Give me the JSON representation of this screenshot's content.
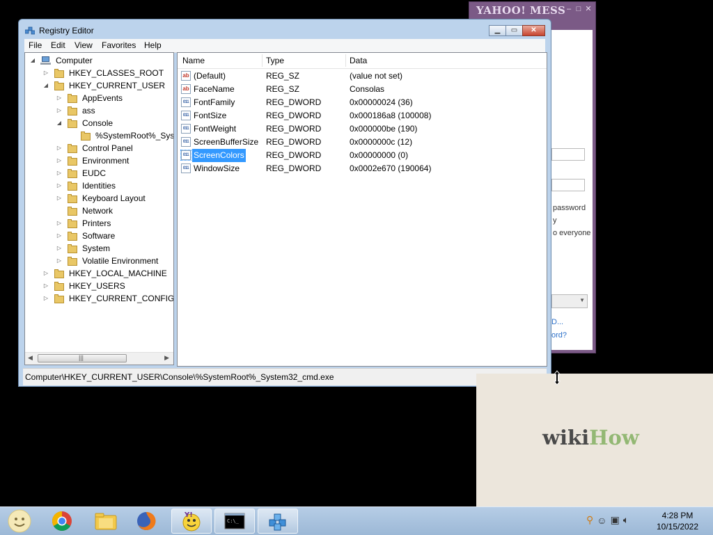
{
  "registry": {
    "title": "Registry Editor",
    "menu": [
      "File",
      "Edit",
      "View",
      "Favorites",
      "Help"
    ],
    "tree": {
      "root": "Computer",
      "hkcr": "HKEY_CLASSES_ROOT",
      "hkcu": "HKEY_CURRENT_USER",
      "hkcu_children": [
        "AppEvents",
        "ass",
        "Console",
        "%SystemRoot%_System32_cmd.exe",
        "Control Panel",
        "Environment",
        "EUDC",
        "Identities",
        "Keyboard Layout",
        "Network",
        "Printers",
        "Software",
        "System",
        "Volatile Environment"
      ],
      "hklm": "HKEY_LOCAL_MACHINE",
      "hku": "HKEY_USERS",
      "hkcc": "HKEY_CURRENT_CONFIG"
    },
    "columns": {
      "name": "Name",
      "type": "Type",
      "data": "Data"
    },
    "values": [
      {
        "name": "(Default)",
        "type": "REG_SZ",
        "data": "(value not set)",
        "icon": "string-value-icon"
      },
      {
        "name": "FaceName",
        "type": "REG_SZ",
        "data": "Consolas",
        "icon": "string-value-icon"
      },
      {
        "name": "FontFamily",
        "type": "REG_DWORD",
        "data": "0x00000024 (36)",
        "icon": "dword-value-icon"
      },
      {
        "name": "FontSize",
        "type": "REG_DWORD",
        "data": "0x000186a8 (100008)",
        "icon": "dword-value-icon"
      },
      {
        "name": "FontWeight",
        "type": "REG_DWORD",
        "data": "0x000000be (190)",
        "icon": "dword-value-icon"
      },
      {
        "name": "ScreenBufferSize",
        "type": "REG_DWORD",
        "data": "0x0000000c (12)",
        "icon": "dword-value-icon"
      },
      {
        "name": "ScreenColors",
        "type": "REG_DWORD",
        "data": "0x00000000 (0)",
        "icon": "dword-value-icon",
        "selected": true
      },
      {
        "name": "WindowSize",
        "type": "REG_DWORD",
        "data": "0x0002e670 (190064)",
        "icon": "dword-value-icon"
      }
    ],
    "status": "Computer\\HKEY_CURRENT_USER\\Console\\%SystemRoot%_System32_cmd.exe",
    "selection_color": "#3399ff"
  },
  "yahoo": {
    "title": "YAHOO! MESS",
    "partial_texts": [
      "password",
      "y",
      "o everyone",
      "D...",
      "ord?"
    ]
  },
  "watermark": {
    "part1": "wiki",
    "part2": "How"
  },
  "taskbar": {
    "items": [
      "start-orb",
      "chrome",
      "windows-explorer",
      "firefox",
      "yahoo-messenger",
      "command-prompt",
      "registry-editor"
    ],
    "clock_time": "4:28 PM",
    "clock_date": "10/15/2022"
  }
}
